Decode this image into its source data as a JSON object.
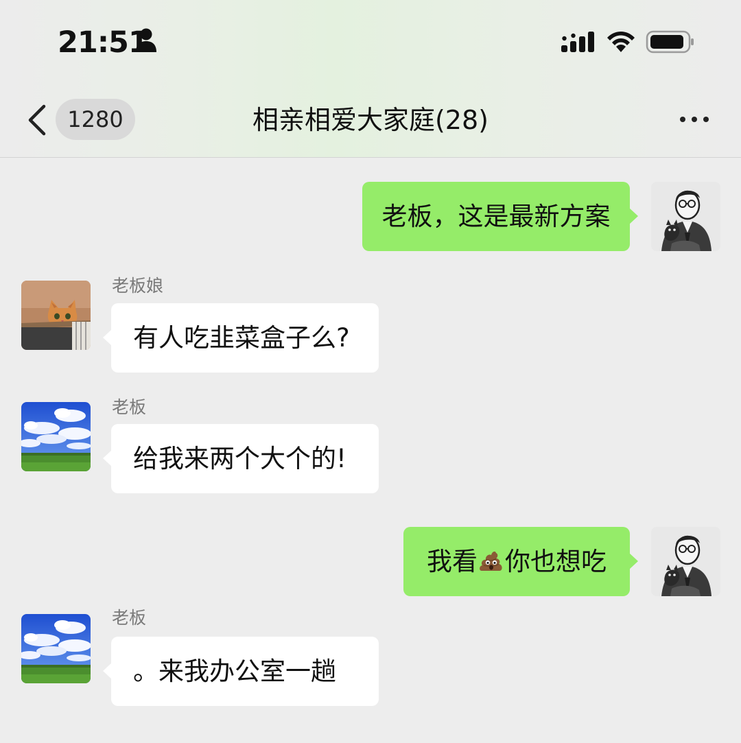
{
  "status_bar": {
    "time": "21:51"
  },
  "header": {
    "unread_count": "1280",
    "title": "相亲相爱大家庭(28)"
  },
  "messages": [
    {
      "direction": "outgoing",
      "text": "老板，这是最新方案",
      "avatar": "sketch-portrait"
    },
    {
      "direction": "incoming",
      "sender": "老板娘",
      "text": "有人吃韭菜盒子么?",
      "avatar": "cat-photo"
    },
    {
      "direction": "incoming",
      "sender": "老板",
      "text": "给我来两个大个的!",
      "avatar": "sky-landscape"
    },
    {
      "direction": "outgoing",
      "text_before": "我看",
      "emoji": "poop-emoji",
      "text_after": "你也想吃",
      "avatar": "sketch-portrait"
    },
    {
      "direction": "incoming",
      "sender": "老板",
      "text": "。来我办公室一趟",
      "avatar": "sky-landscape"
    }
  ],
  "colors": {
    "background": "#ededed",
    "outgoing_bubble": "#95ec69",
    "incoming_bubble": "#ffffff",
    "badge": "#d9d9d9"
  }
}
